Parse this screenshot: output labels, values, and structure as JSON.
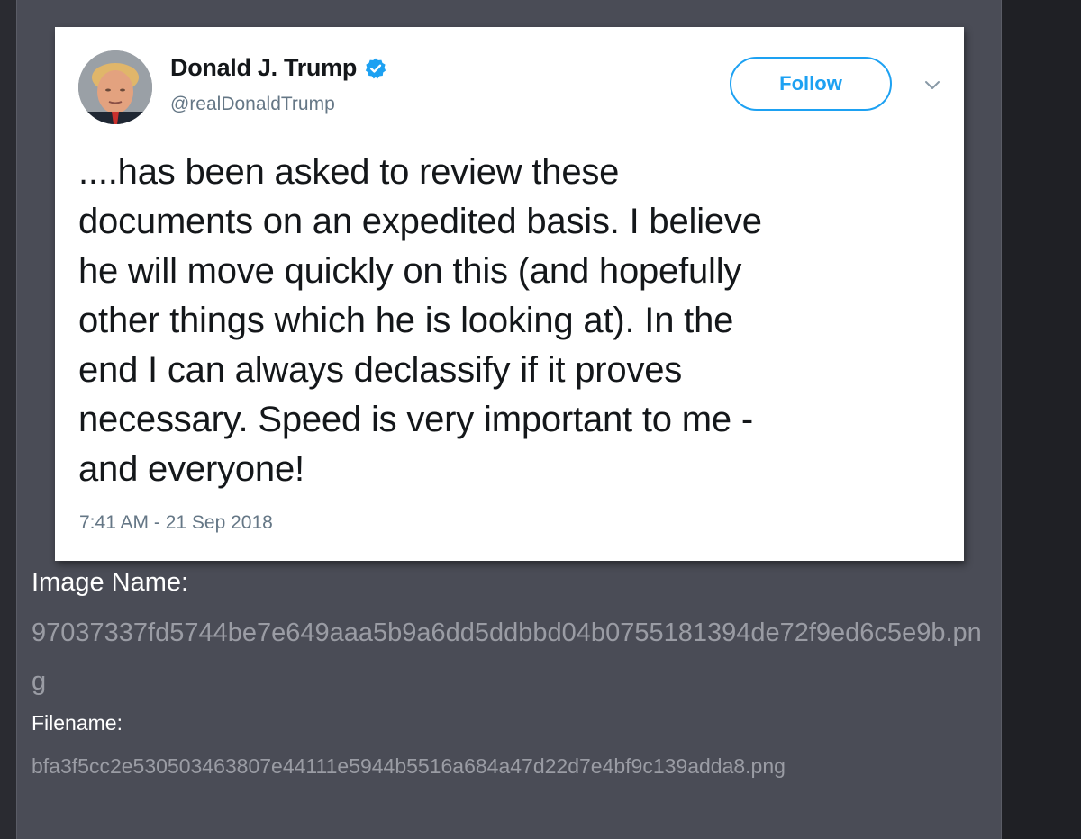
{
  "tweet": {
    "display_name": "Donald J. Trump",
    "handle": "@realDonaldTrump",
    "follow_label": "Follow",
    "text": "....has been asked to review these\ndocuments on an expedited basis. I believe\nhe will move quickly on this (and hopefully\nother things which he is looking at). In the\nend I can always declassify if it proves\nnecessary. Speed is very important to me -\nand everyone!",
    "timestamp": "7:41 AM - 21 Sep 2018",
    "verified": true,
    "icons": {
      "avatar": "avatar",
      "verified": "verified-badge-icon",
      "menu": "chevron-down-icon"
    },
    "colors": {
      "accent": "#1da1f2",
      "text": "#14171a",
      "muted": "#657786"
    }
  },
  "metadata": {
    "image_name_label": "Image Name:",
    "image_name_value": "97037337fd5744be7e649aaa5b9a6dd5ddbbd04b0755181394de72f9ed6c5e9b.png",
    "filename_label": "Filename:",
    "filename_value": "bfa3f5cc2e530503463807e44111e5944b5516a684a47d22d7e4bf9c139adda8.png"
  },
  "colors": {
    "panel_bg": "#4a4c56",
    "label_text": "#ffffff",
    "value_text": "#9a9ca4"
  }
}
